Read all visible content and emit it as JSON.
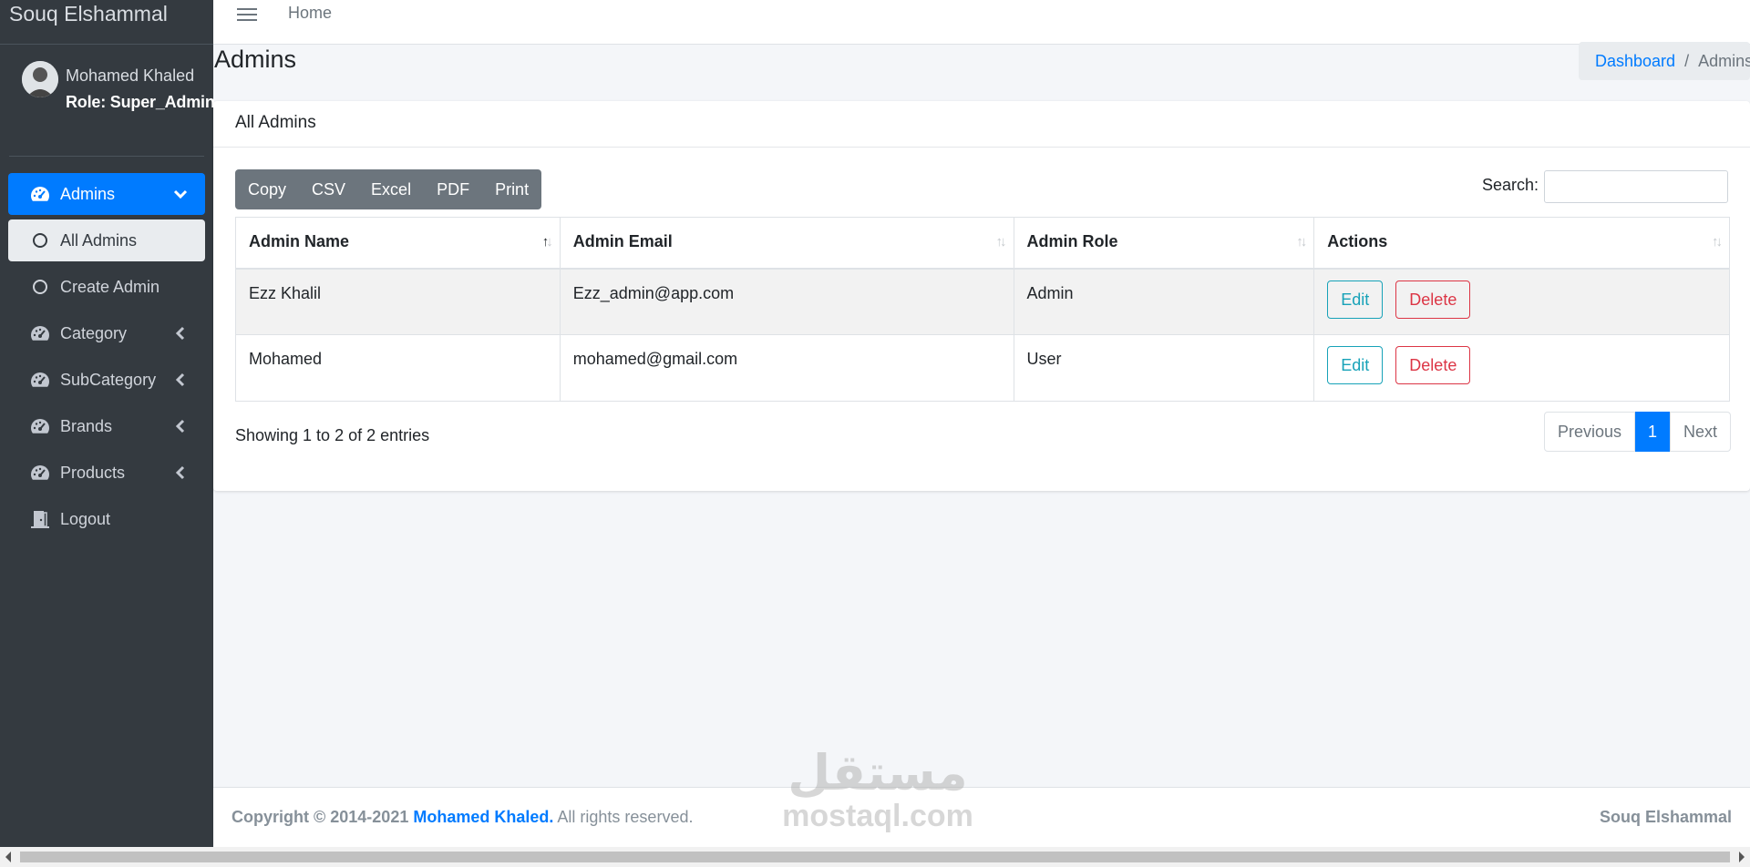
{
  "app": {
    "brand": "Souq Elshammal"
  },
  "user": {
    "name": "Mohamed Khaled",
    "role": "Role: Super_Admin"
  },
  "sidebar": {
    "items": [
      {
        "label": "Admins",
        "icon": "tachometer-icon"
      },
      {
        "label": "All Admins",
        "icon": "circle-icon"
      },
      {
        "label": "Create Admin",
        "icon": "circle-icon"
      },
      {
        "label": "Category",
        "icon": "tachometer-icon"
      },
      {
        "label": "SubCategory",
        "icon": "tachometer-icon"
      },
      {
        "label": "Brands",
        "icon": "tachometer-icon"
      },
      {
        "label": "Products",
        "icon": "tachometer-icon"
      },
      {
        "label": "Logout",
        "icon": "door-icon"
      }
    ]
  },
  "topbar": {
    "home": "Home"
  },
  "header": {
    "title": "Admins"
  },
  "breadcrumb": {
    "link": "Dashboard",
    "separator": "/",
    "current": "Admins"
  },
  "card": {
    "title": "All Admins"
  },
  "toolbar": {
    "buttons": [
      "Copy",
      "CSV",
      "Excel",
      "PDF",
      "Print"
    ]
  },
  "search": {
    "label": "Search:",
    "value": ""
  },
  "table": {
    "columns": [
      "Admin Name",
      "Admin Email",
      "Admin Role",
      "Actions"
    ],
    "rows": [
      {
        "name": "Ezz Khalil",
        "email": "Ezz_admin@app.com",
        "role": "Admin",
        "edit": "Edit",
        "delete": "Delete"
      },
      {
        "name": "Mohamed",
        "email": "mohamed@gmail.com",
        "role": "User",
        "edit": "Edit",
        "delete": "Delete"
      }
    ]
  },
  "info": "Showing 1 to 2 of 2 entries",
  "pagination": {
    "previous": "Previous",
    "page": "1",
    "next": "Next"
  },
  "footer": {
    "copyright_prefix": "Copyright © 2014-2021",
    "author": "Mohamed Khaled.",
    "rights": "All rights reserved.",
    "brand": "Souq Elshammal"
  },
  "watermark": {
    "arabic": "مستقل",
    "latin": "mostaql.com"
  },
  "colors": {
    "accent": "#007bff",
    "sidebar": "#343a40",
    "edit": "#17a2b8",
    "delete": "#dc3545"
  }
}
